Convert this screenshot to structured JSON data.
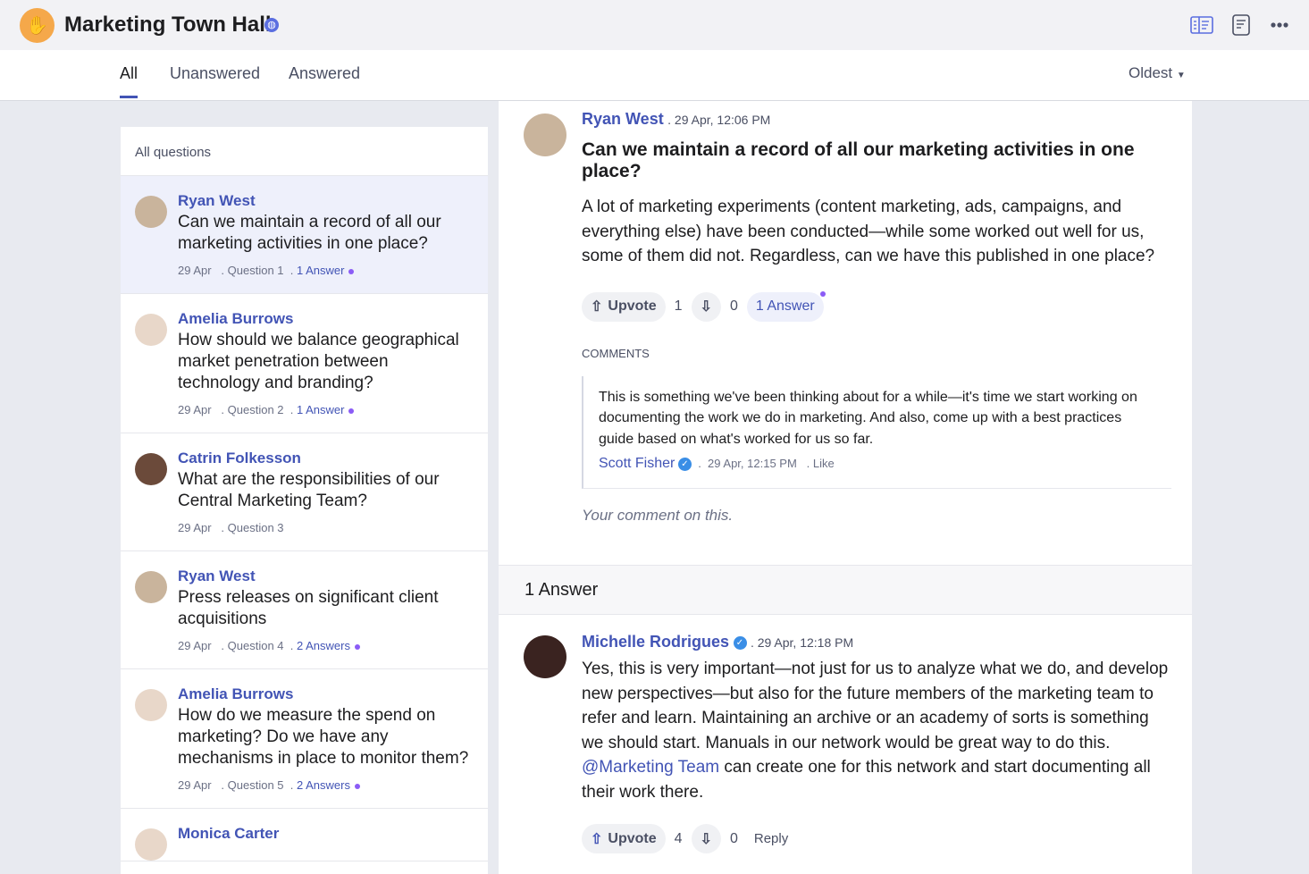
{
  "header": {
    "title": "Marketing Town Hall",
    "icons": [
      "hand-logo-icon",
      "globe-icon",
      "split-view-icon",
      "document-icon",
      "more-icon"
    ]
  },
  "tabs": [
    {
      "label": "All"
    },
    {
      "label": "Unanswered"
    },
    {
      "label": "Answered"
    }
  ],
  "sort": {
    "label": "Oldest"
  },
  "sidebar": {
    "heading": "All questions",
    "items": [
      {
        "author": "Ryan West",
        "text": "Can we maintain a record of all our marketing activities in one place?",
        "date": "29 Apr",
        "question": "Question 1",
        "answers": "1 Answer"
      },
      {
        "author": "Amelia Burrows",
        "text": "How should we balance geographical market penetration between technology and branding?",
        "date": "29 Apr",
        "question": "Question 2",
        "answers": "1 Answer"
      },
      {
        "author": "Catrin Folkesson",
        "text": "What are the responsibilities of our Central Marketing Team?",
        "date": "29 Apr",
        "question": "Question 3",
        "answers": ""
      },
      {
        "author": "Ryan West",
        "text": "Press releases on significant client acquisitions",
        "date": "29 Apr",
        "question": "Question 4",
        "answers": "2 Answers"
      },
      {
        "author": "Amelia Burrows",
        "text": "How do we measure the spend on marketing? Do we have any mechanisms in place to monitor them?",
        "date": "29 Apr",
        "question": "Question 5",
        "answers": "2 Answers"
      },
      {
        "author": "Monica Carter",
        "text": "",
        "date": "",
        "question": "",
        "answers": ""
      }
    ]
  },
  "question": {
    "author": "Ryan West",
    "time": ". 29 Apr, 12:06 PM",
    "title": "Can we maintain a record of all our marketing activities in one place?",
    "body": "A lot of marketing experiments (content marketing, ads, campaigns, and everything else) have been conducted—while some worked out well for us, some of them did not. Regardless, can we have this published in one place?",
    "upvote_label": "Upvote",
    "upvotes": "1",
    "downvotes": "0",
    "answers_label": "1 Answer",
    "comments_label": "COMMENTS",
    "comment": {
      "text": "This is something we've been thinking about for a while—it's time we start working on documenting the work we do in marketing. And also, come up with a best practices guide based on what's worked for us so far.",
      "author": "Scott Fisher",
      "time": "29 Apr, 12:15 PM",
      "like": "Like"
    },
    "comment_placeholder": "Your comment on this."
  },
  "answers_heading": "1 Answer",
  "answer": {
    "author": "Michelle Rodrigues",
    "time": ". 29 Apr, 12:18 PM",
    "body_before": "Yes, this is very important—not just for us to analyze what we do, and develop new perspectives—but also for the future members of the marketing team to refer and learn. Maintaining an archive or an academy of sorts is something we should start. Manuals in our network would be great way to do this. ",
    "mention": "@Marketing Team",
    "body_after": " can create one for this network and start documenting all their work there.",
    "upvote_label": "Upvote",
    "upvotes": "4",
    "downvotes": "0",
    "reply": "Reply"
  }
}
